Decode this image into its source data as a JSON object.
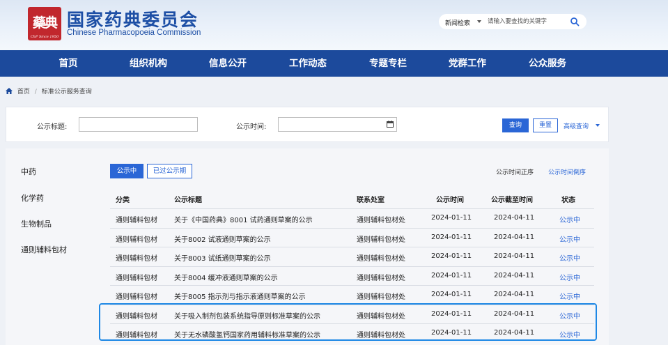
{
  "header": {
    "seal_char": "藥典",
    "seal_since": "ChP Since 1950",
    "title_cn": "国家药典委员会",
    "title_en": "Chinese Pharmacopoeia Commission",
    "search": {
      "category": "新闻检索",
      "placeholder": "请输入要查找的关键字",
      "icon": "search-icon"
    }
  },
  "nav": [
    "首页",
    "组织机构",
    "信息公开",
    "工作动态",
    "专题专栏",
    "党群工作",
    "公众服务"
  ],
  "breadcrumb": {
    "home": "首页",
    "sep": "/",
    "current": "标准公示服务查询"
  },
  "filter": {
    "title_label": "公示标题:",
    "title_value": "",
    "time_label": "公示时间:",
    "time_value": "",
    "query": "查询",
    "reset": "重置",
    "advanced": "高级查询"
  },
  "sidebar": [
    "中药",
    "化学药",
    "生物制品",
    "通则辅料包材"
  ],
  "tabs": {
    "active": "公示中",
    "inactive": "已过公示期"
  },
  "sort": {
    "asc": "公示时间正序",
    "desc": "公示时间倒序"
  },
  "table": {
    "headers": [
      "分类",
      "公示标题",
      "联系处室",
      "公示时间",
      "公示截至时间",
      "状态"
    ],
    "rows": [
      [
        "通则辅料包材",
        "关于《中国药典》8001 试药通则草案的公示",
        "通则辅料包材处",
        "2024-01-11",
        "2024-04-11",
        "公示中"
      ],
      [
        "通则辅料包材",
        "关于8002 试液通则草案的公示",
        "通则辅料包材处",
        "2024-01-11",
        "2024-04-11",
        "公示中"
      ],
      [
        "通则辅料包材",
        "关于8003 试纸通则草案的公示",
        "通则辅料包材处",
        "2024-01-11",
        "2024-04-11",
        "公示中"
      ],
      [
        "通则辅料包材",
        "关于8004 缓冲液通则草案的公示",
        "通则辅料包材处",
        "2024-01-11",
        "2024-04-11",
        "公示中"
      ],
      [
        "通则辅料包材",
        "关于8005 指示剂与指示液通则草案的公示",
        "通则辅料包材处",
        "2024-01-11",
        "2024-04-11",
        "公示中"
      ],
      [
        "通则辅料包材",
        "关于吸入制剂包装系统指导原则标准草案的公示",
        "通则辅料包材处",
        "2024-01-11",
        "2024-04-11",
        "公示中"
      ],
      [
        "通则辅料包材",
        "关于无水磷酸氢钙国家药用辅料标准草案的公示",
        "通则辅料包材处",
        "2024-01-11",
        "2024-04-11",
        "公示中"
      ]
    ]
  },
  "colors": {
    "brand_blue": "#1c4a9c",
    "link_blue": "#2a66d6",
    "seal_red": "#c1272d",
    "highlight": "#1e88e5"
  }
}
